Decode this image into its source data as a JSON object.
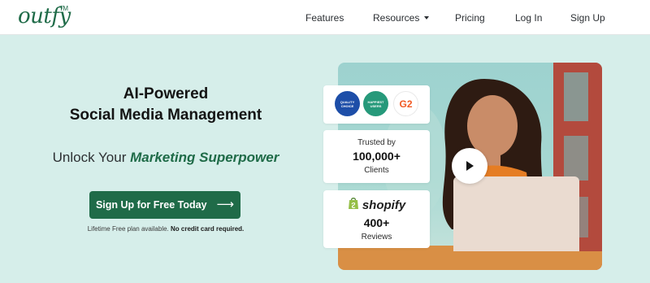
{
  "brand": {
    "logo": "outfy",
    "tm": "TM",
    "accent": "#1f6b48"
  },
  "nav": {
    "features": "Features",
    "resources": "Resources",
    "pricing": "Pricing",
    "login": "Log In",
    "signup": "Sign Up"
  },
  "hero": {
    "headline_line1": "AI-Powered",
    "headline_line2": "Social Media Management",
    "subhead_prefix": "Unlock Your",
    "subhead_highlight": "Marketing Superpower",
    "cta_label": "Sign Up for Free Today",
    "cta_arrow": "⟶",
    "note_prefix": "Lifetime Free plan available.",
    "note_bold": "No credit card required."
  },
  "stats": {
    "trusted_by": "Trusted by",
    "clients_count": "100,000+",
    "clients_label": "Clients",
    "shopify_label": "shopify",
    "reviews_count": "400+",
    "reviews_label": "Reviews"
  },
  "badges": {
    "quality_choice": "QUALITY CHOICE",
    "happiest_users": "HAPPIEST USERS",
    "g2": "G2"
  },
  "icons": {
    "play": "play-icon",
    "shopify_bag": "shopify-bag-icon",
    "caret": "chevron-down-icon"
  }
}
